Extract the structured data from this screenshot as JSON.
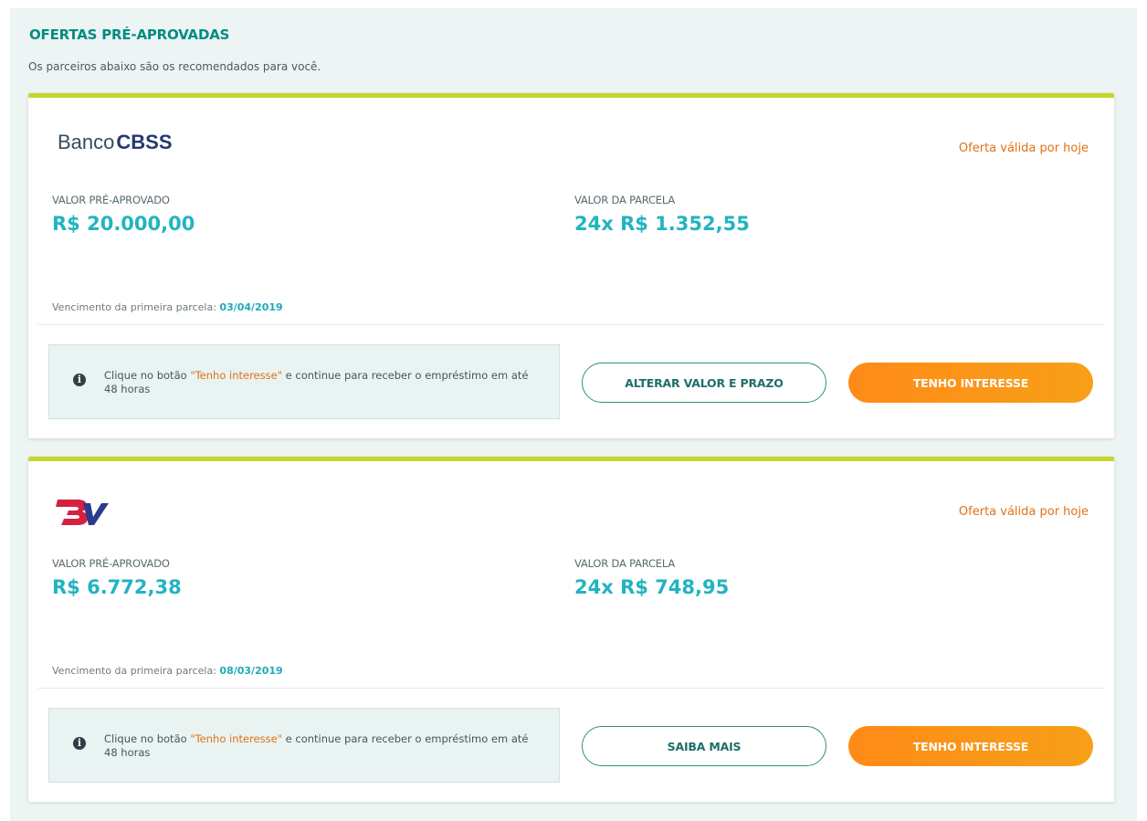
{
  "header": {
    "title": "OFERTAS PRÉ-APROVADAS",
    "subtitle": "Os parceiros abaixo são os recomendados para você."
  },
  "offers": [
    {
      "bank": {
        "logo_prefix": "Banco",
        "logo_name": "CBSS",
        "logo_icon": "banco-cbss-logo"
      },
      "validity": "Oferta válida por hoje",
      "preapproved_label": "VALOR PRÉ-APROVADO",
      "preapproved_value": "R$ 20.000,00",
      "installment_label": "VALOR DA PARCELA",
      "installment_value": "24x R$ 1.352,55",
      "due_label": "Vencimento da primeira parcela: ",
      "due_date": "03/04/2019",
      "info": {
        "before": "Clique no botão ",
        "highlight": "\"Tenho interesse\"",
        "after": " e continue para receber o empréstimo em até 48 horas"
      },
      "secondary_button": "ALTERAR VALOR E PRAZO",
      "primary_button": "TENHO INTERESSE"
    },
    {
      "bank": {
        "logo_icon": "bv-logo"
      },
      "validity": "Oferta válida por hoje",
      "preapproved_label": "VALOR PRÉ-APROVADO",
      "preapproved_value": "R$ 6.772,38",
      "installment_label": "VALOR DA PARCELA",
      "installment_value": "24x R$ 748,95",
      "due_label": "Vencimento da primeira parcela: ",
      "due_date": "08/03/2019",
      "info": {
        "before": "Clique no botão ",
        "highlight": "\"Tenho interesse\"",
        "after": " e continue para receber o empréstimo em até 48 horas"
      },
      "secondary_button": "SAIBA MAIS",
      "primary_button": "TENHO INTERESSE"
    }
  ],
  "colors": {
    "accent_teal": "#008c82",
    "value_cyan": "#21b4c0",
    "orange": "#e27114",
    "card_top_border": "#c6d62a",
    "bv_logo_red": "#d5213f"
  }
}
